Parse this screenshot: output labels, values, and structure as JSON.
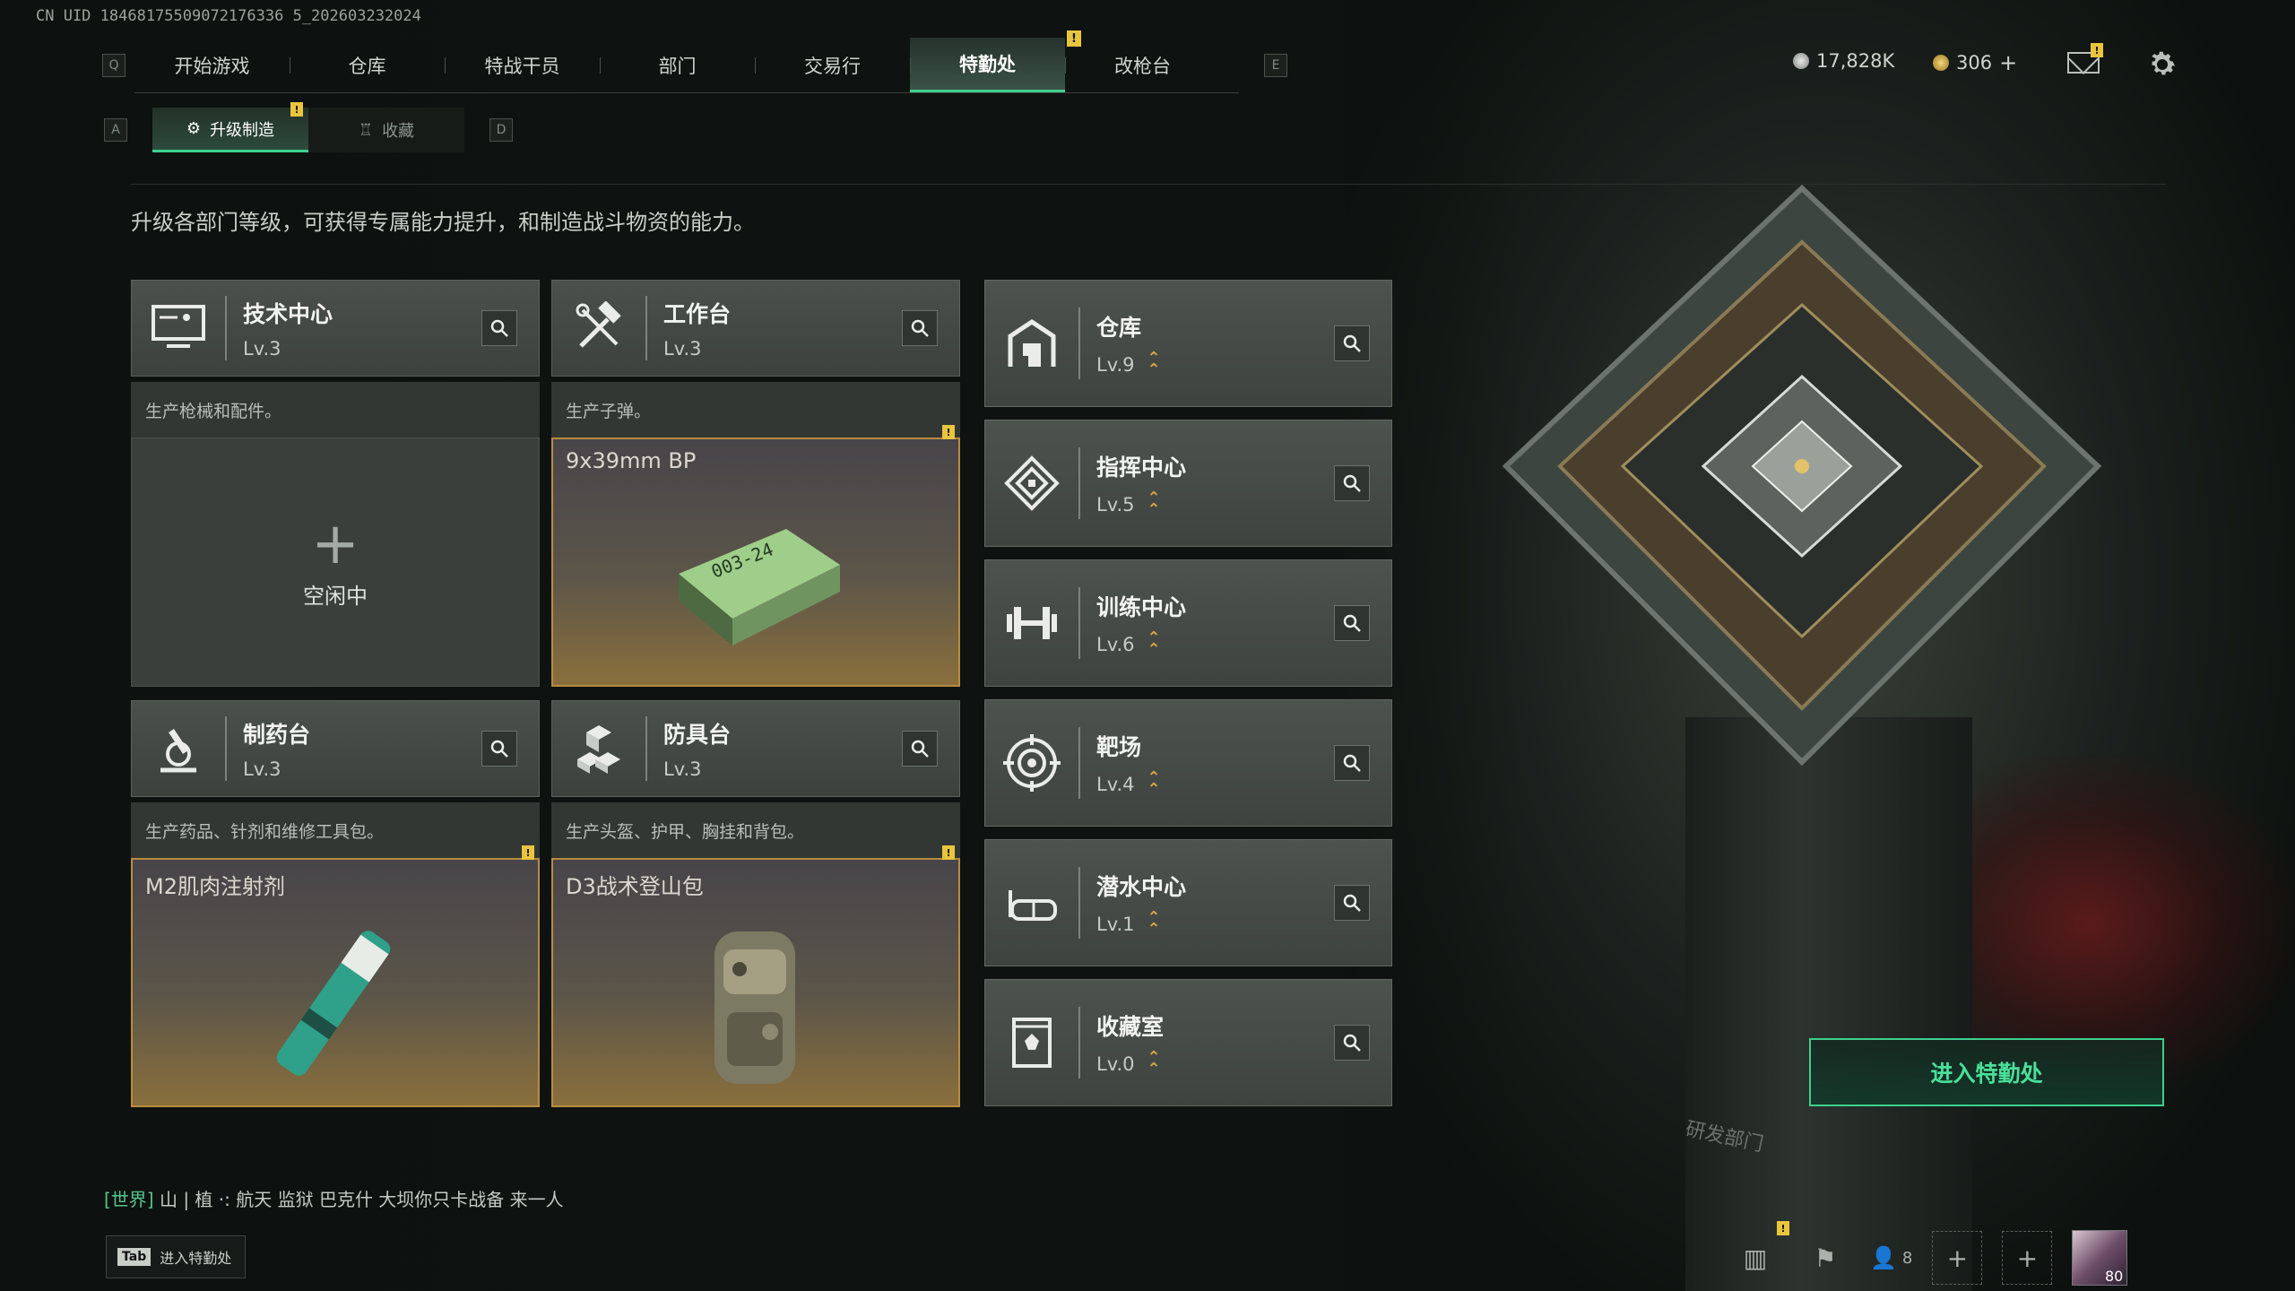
{
  "uid_text": "CN UID 18468175509072176336 5_202603232024",
  "topnav": {
    "left_key": "Q",
    "right_key": "E",
    "tabs": [
      {
        "label": "开始游戏"
      },
      {
        "label": "仓库"
      },
      {
        "label": "特战干员"
      },
      {
        "label": "部门"
      },
      {
        "label": "交易行"
      },
      {
        "label": "特勤处",
        "active": true
      },
      {
        "label": "改枪台"
      }
    ]
  },
  "currency": {
    "silver": "17,828K",
    "gold": "306"
  },
  "subnav": {
    "left_key": "A",
    "right_key": "D",
    "tabs": [
      {
        "label": "升级制造",
        "active": true
      },
      {
        "label": "收藏"
      }
    ]
  },
  "description": "升级各部门等级，可获得专属能力提升，和制造战斗物资的能力。",
  "production": [
    {
      "name": "技术中心",
      "level": "Lv.3",
      "desc": "生产枪械和配件。",
      "state": "idle",
      "idle_text": "空闲中",
      "icon": "computer-icon"
    },
    {
      "name": "工作台",
      "level": "Lv.3",
      "desc": "生产子弹。",
      "state": "producing",
      "item": "9x39mm BP",
      "icon": "hammer-wrench-icon"
    },
    {
      "name": "制药台",
      "level": "Lv.3",
      "desc": "生产药品、针剂和维修工具包。",
      "state": "producing",
      "item": "M2肌肉注射剂",
      "icon": "microscope-icon"
    },
    {
      "name": "防具台",
      "level": "Lv.3",
      "desc": "生产头盔、护甲、胸挂和背包。",
      "state": "producing",
      "item": "D3战术登山包",
      "icon": "boxes-icon"
    }
  ],
  "departments": [
    {
      "name": "仓库",
      "level": "Lv.9",
      "icon": "warehouse-icon"
    },
    {
      "name": "指挥中心",
      "level": "Lv.5",
      "icon": "command-icon"
    },
    {
      "name": "训练中心",
      "level": "Lv.6",
      "icon": "dumbbell-icon"
    },
    {
      "name": "靶场",
      "level": "Lv.4",
      "icon": "target-icon"
    },
    {
      "name": "潜水中心",
      "level": "Lv.1",
      "icon": "diving-mask-icon"
    },
    {
      "name": "收藏室",
      "level": "Lv.0",
      "icon": "display-case-icon"
    }
  ],
  "enter_button": "进入特勤处",
  "chat": {
    "channel": "[世界]",
    "text": "山 | 植 ·: 航天 监狱 巴克什 大坝你只卡战备 来一人"
  },
  "tab_hint": {
    "key": "Tab",
    "label": "进入特勤处"
  },
  "friends_count": "8",
  "player_level": "80",
  "scene_sign": "研发部门",
  "colors": {
    "accent": "#3ecf8f",
    "alert": "#e9c53d",
    "upgrade": "#d8a745"
  }
}
